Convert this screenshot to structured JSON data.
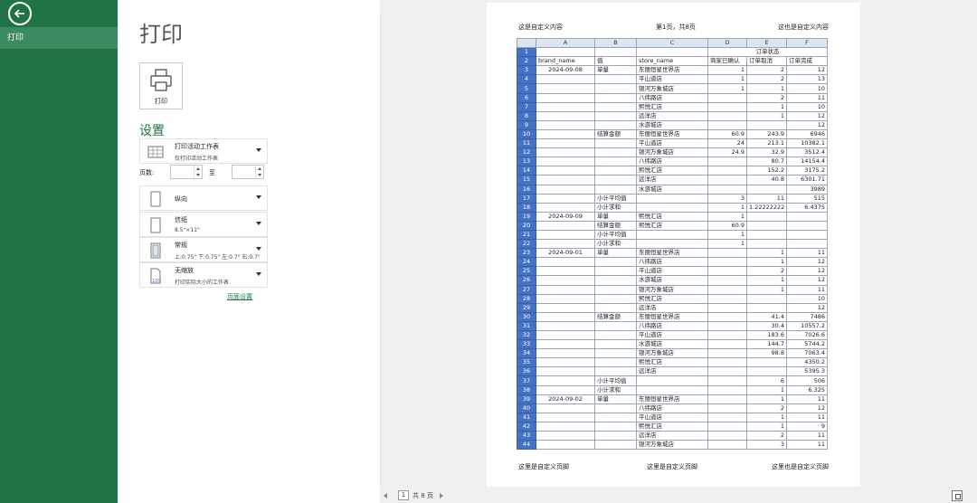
{
  "nav": {
    "print_label": "打印"
  },
  "panel": {
    "title": "打印",
    "print_button_label": "打印",
    "settings_heading": "设置",
    "page_setup_link": "页面设置"
  },
  "settings": {
    "what_main": "打印活动工作表",
    "what_sub": "仅打印活动工作表",
    "pages_label": "页数:",
    "pages_to": "至",
    "pages_from_value": "",
    "pages_to_value": "",
    "orientation_main": "纵向",
    "paper_main": "信纸",
    "paper_sub": "8.5\"×11\"",
    "margins_main": "常规",
    "margins_sub": "上:0.75\" 下:0.75\" 左:0.7\" 右:0.7\"",
    "scaling_main": "无缩放",
    "scaling_sub": "打印实际大小的工作表"
  },
  "sheet": {
    "header_left": "这是自定义内容",
    "header_center": "第1页，共8页",
    "header_right": "这也是自定义内容",
    "footer_left": "这里是自定义页脚",
    "footer_center": "这里是自定义页脚",
    "footer_right": "这里也是自定义页脚",
    "columns": [
      "A",
      "B",
      "C",
      "D",
      "E",
      "F"
    ],
    "row1_label": "订单状态",
    "row2": [
      "brand_name",
      "值",
      "store_name",
      "商家已确认",
      "订单取消",
      "订单完成"
    ],
    "rows": [
      [
        "3",
        "2024-09-08",
        "单量",
        "东丽恒星世界店",
        "1",
        "2",
        "12"
      ],
      [
        "4",
        "",
        "",
        "平山道店",
        "1",
        "2",
        "13"
      ],
      [
        "5",
        "",
        "",
        "银河万象城店",
        "1",
        "1",
        "10"
      ],
      [
        "6",
        "",
        "",
        "八纬路店",
        "",
        "2",
        "11"
      ],
      [
        "7",
        "",
        "",
        "熙悦汇店",
        "",
        "1",
        "10"
      ],
      [
        "8",
        "",
        "",
        "远洋店",
        "",
        "1",
        "12"
      ],
      [
        "9",
        "",
        "",
        "水游城店",
        "",
        "",
        "12"
      ],
      [
        "10",
        "",
        "结算金额",
        "东丽恒星世界店",
        "60.9",
        "243.9",
        "6946"
      ],
      [
        "11",
        "",
        "",
        "平山道店",
        "24",
        "213.1",
        "10382.1"
      ],
      [
        "12",
        "",
        "",
        "银河万象城店",
        "24.9",
        "32.9",
        "3512.4"
      ],
      [
        "13",
        "",
        "",
        "八纬路店",
        "",
        "80.7",
        "14154.4"
      ],
      [
        "14",
        "",
        "",
        "熙悦汇店",
        "",
        "152.2",
        "3175.2"
      ],
      [
        "15",
        "",
        "",
        "远洋店",
        "",
        "40.8",
        "6301.71"
      ],
      [
        "16",
        "",
        "",
        "水游城店",
        "",
        "",
        "3989"
      ],
      [
        "17",
        "",
        "小计平均值",
        "",
        "3",
        "11",
        "515"
      ],
      [
        "18",
        "",
        "小计求和",
        "",
        "1",
        "1.22222222",
        "6.4375"
      ],
      [
        "19",
        "2024-09-09",
        "单量",
        "熙悦汇店",
        "1",
        "",
        ""
      ],
      [
        "20",
        "",
        "结算金额",
        "熙悦汇店",
        "60.9",
        "",
        ""
      ],
      [
        "21",
        "",
        "小计平均值",
        "",
        "1",
        "",
        ""
      ],
      [
        "22",
        "",
        "小计求和",
        "",
        "1",
        "",
        ""
      ],
      [
        "23",
        "2024-09-01",
        "单量",
        "东丽恒星世界店",
        "",
        "1",
        "11"
      ],
      [
        "24",
        "",
        "",
        "八纬路店",
        "",
        "1",
        "12"
      ],
      [
        "25",
        "",
        "",
        "平山道店",
        "",
        "2",
        "12"
      ],
      [
        "26",
        "",
        "",
        "水游城店",
        "",
        "1",
        "12"
      ],
      [
        "27",
        "",
        "",
        "银河万象城店",
        "",
        "1",
        "11"
      ],
      [
        "28",
        "",
        "",
        "熙悦汇店",
        "",
        "",
        "10"
      ],
      [
        "29",
        "",
        "",
        "远洋店",
        "",
        "",
        "12"
      ],
      [
        "30",
        "",
        "结算金额",
        "东丽恒星世界店",
        "",
        "41.4",
        "7486"
      ],
      [
        "31",
        "",
        "",
        "八纬路店",
        "",
        "30.4",
        "10557.2"
      ],
      [
        "32",
        "",
        "",
        "平山道店",
        "",
        "183.6",
        "7026.6"
      ],
      [
        "33",
        "",
        "",
        "水游城店",
        "",
        "144.7",
        "5744.2"
      ],
      [
        "34",
        "",
        "",
        "银河万象城店",
        "",
        "98.8",
        "7063.4"
      ],
      [
        "35",
        "",
        "",
        "熙悦汇店",
        "",
        "",
        "4350.2"
      ],
      [
        "36",
        "",
        "",
        "远洋店",
        "",
        "",
        "5395.3"
      ],
      [
        "37",
        "",
        "小计平均值",
        "",
        "",
        "6",
        "506"
      ],
      [
        "38",
        "",
        "小计求和",
        "",
        "",
        "1",
        "6.325"
      ],
      [
        "39",
        "2024-09-02",
        "单量",
        "东丽恒星世界店",
        "",
        "1",
        "11"
      ],
      [
        "40",
        "",
        "",
        "八纬路店",
        "",
        "2",
        "12"
      ],
      [
        "41",
        "",
        "",
        "平山道店",
        "",
        "1",
        "11"
      ],
      [
        "42",
        "",
        "",
        "熙悦汇店",
        "",
        "1",
        "9"
      ],
      [
        "43",
        "",
        "",
        "远洋店",
        "",
        "2",
        "11"
      ],
      [
        "44",
        "",
        "",
        "银河万象城店",
        "",
        "3",
        "11"
      ]
    ]
  },
  "pager": {
    "current": "1",
    "total": "共 8 页"
  },
  "colors": {
    "nav": "#217346",
    "row_header": "#4472c4",
    "col_header": "#dbe5f1"
  }
}
